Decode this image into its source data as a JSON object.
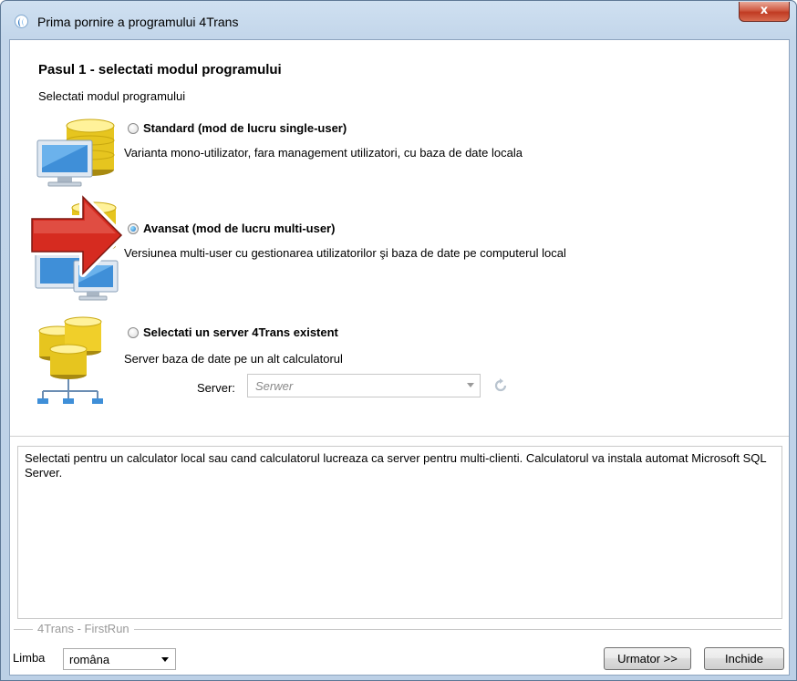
{
  "window": {
    "title": "Prima pornire a programului 4Trans",
    "close_glyph": "x",
    "icon": "app-logo-icon"
  },
  "wizard": {
    "step_title": "Pasul 1 - selectati modul programului",
    "step_subtitle": "Selectati modul programului",
    "options": [
      {
        "label": "Standard (mod de lucru single-user)",
        "description": "Varianta mono-utilizator, fara management utilizatori, cu baza de date locala",
        "selected": false,
        "icon": "computer-database-icon"
      },
      {
        "label": "Avansat (mod de lucru multi-user)",
        "description": "Versiunea multi-user cu gestionarea  utilizatorilor şi baza de date pe computerul local",
        "selected": true,
        "icon": "multi-computer-icon"
      },
      {
        "label": "Selectati un server 4Trans existent",
        "description": "Server baza de date pe un alt calculatorul",
        "selected": false,
        "icon": "database-server-icon"
      }
    ],
    "server": {
      "label": "Server:",
      "placeholder": "Serwer"
    },
    "info": "Selectati pentru un calculator local sau cand calculatorul lucreaza ca server pentru multi-clienti. Calculatorul va instala automat Microsoft SQL Server."
  },
  "footer": {
    "group_caption": "4Trans - FirstRun",
    "language_label": "Limba",
    "language_value": "româna",
    "next_button": "Urmator >>",
    "close_button": "Inchide"
  },
  "colors": {
    "title_bar": "#c3d6ea",
    "close_button": "#c03a22",
    "arrow": "#d62b20",
    "radio_selected": "#1b73c9"
  }
}
